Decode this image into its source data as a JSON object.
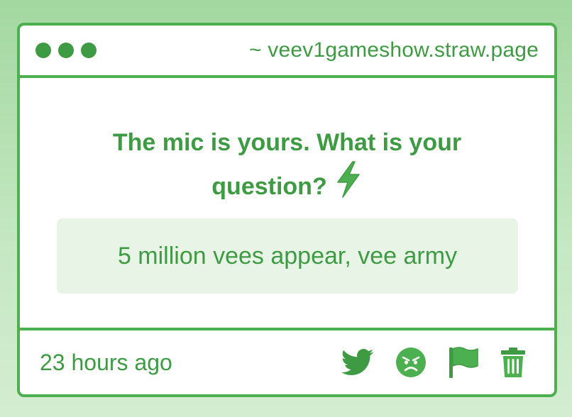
{
  "window": {
    "url": "~ veev1gameshow.straw.page"
  },
  "prompt": {
    "title": "The mic is yours. What is your question?",
    "title_icon": "lightning-bolt-icon"
  },
  "answer": {
    "text": "5 million vees appear, vee army"
  },
  "footer": {
    "timestamp": "23 hours ago",
    "actions": [
      "twitter-icon",
      "angry-face-icon",
      "flag-icon",
      "trash-icon"
    ]
  },
  "colors": {
    "accent": "#4caf50",
    "text": "#3e9b43",
    "answer_bg": "#e8f5e6",
    "page_bg": "#a3d8a0"
  }
}
